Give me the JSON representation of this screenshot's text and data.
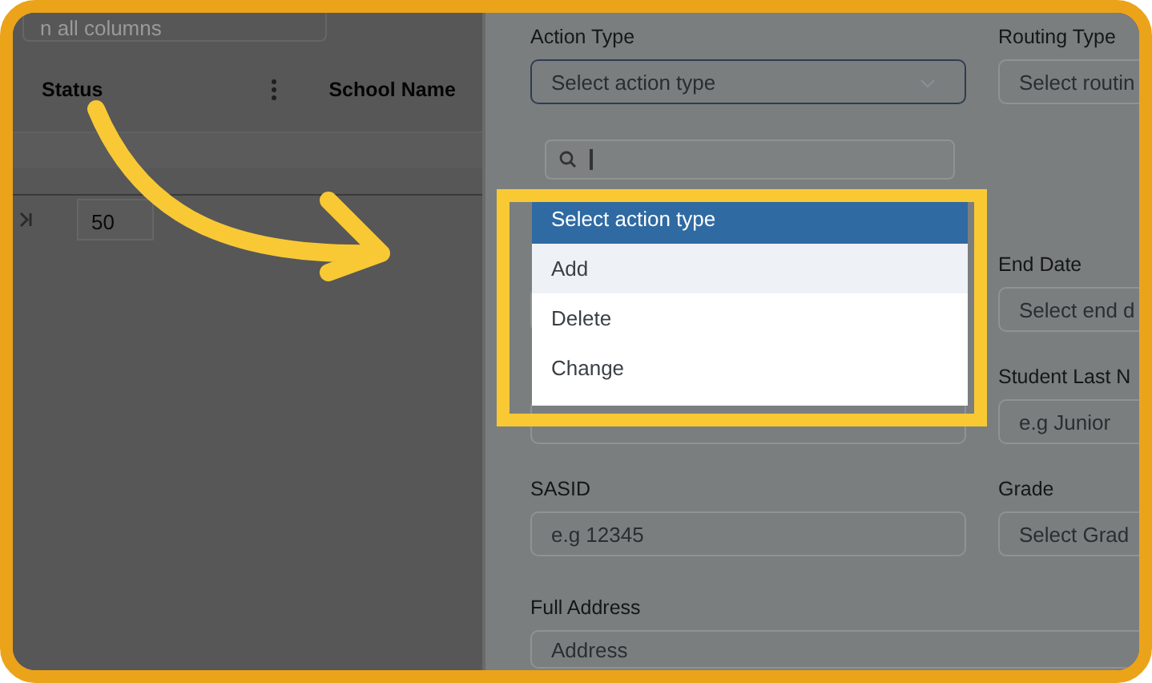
{
  "table": {
    "search_placeholder": "n all columns",
    "columns": [
      {
        "label": "Status"
      },
      {
        "label": "School Name"
      }
    ],
    "page_size": "50"
  },
  "form": {
    "rows": [
      {
        "left": {
          "label": "Action Type",
          "value": "Select action type",
          "focused": true
        },
        "right": {
          "label": "Routing Type",
          "placeholder": "Select routin"
        }
      },
      {
        "right": {
          "label": "End Date",
          "placeholder": "Select end d"
        }
      },
      {
        "right": {
          "label": "Student Last N",
          "placeholder": "e.g Junior"
        }
      },
      {
        "left": {
          "label": "SASID",
          "placeholder": "e.g 12345"
        },
        "right": {
          "label": "Grade",
          "placeholder": "Select Grad"
        }
      },
      {
        "full": {
          "label": "Full Address",
          "placeholder": "Address"
        }
      }
    ]
  },
  "dropdown": {
    "options": [
      {
        "label": "Select action type",
        "selected": true,
        "hovered": false
      },
      {
        "label": "Add",
        "selected": false,
        "hovered": true
      },
      {
        "label": "Delete",
        "selected": false,
        "hovered": false
      },
      {
        "label": "Change",
        "selected": false,
        "hovered": false
      }
    ]
  }
}
